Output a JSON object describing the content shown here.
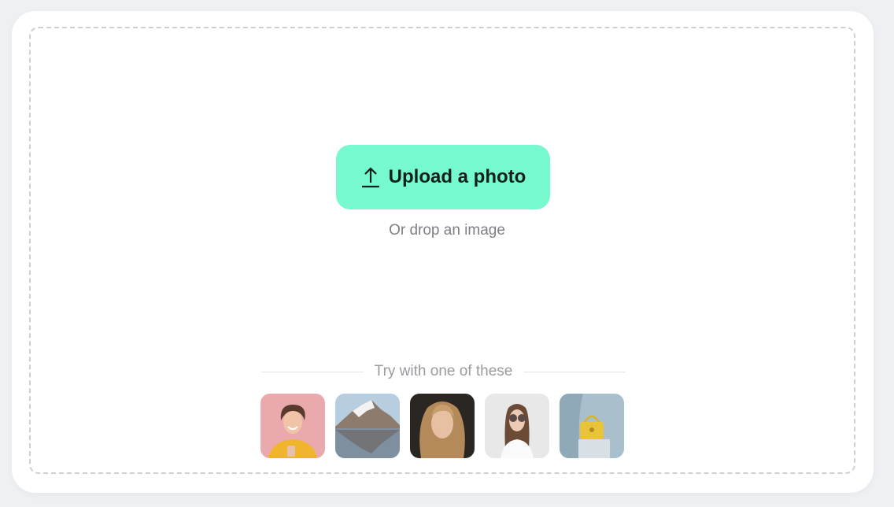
{
  "upload": {
    "button_label": "Upload a photo",
    "icon": "upload-arrow-icon",
    "drop_hint": "Or drop an image"
  },
  "samples": {
    "heading": "Try with one of these",
    "items": [
      {
        "name": "woman-smiling-with-phone",
        "alt": "Smiling woman holding phone"
      },
      {
        "name": "mountain-lake",
        "alt": "Snowy mountain reflected in lake"
      },
      {
        "name": "woman-portrait",
        "alt": "Woman portrait with wavy hair"
      },
      {
        "name": "woman-sunglasses",
        "alt": "Woman wearing sunglasses"
      },
      {
        "name": "yellow-handbag",
        "alt": "Yellow handbag on pedestal"
      }
    ]
  },
  "colors": {
    "accent": "#76f9cf",
    "background": "#eef0f3",
    "card": "#ffffff",
    "dash": "#cfcfd1"
  }
}
